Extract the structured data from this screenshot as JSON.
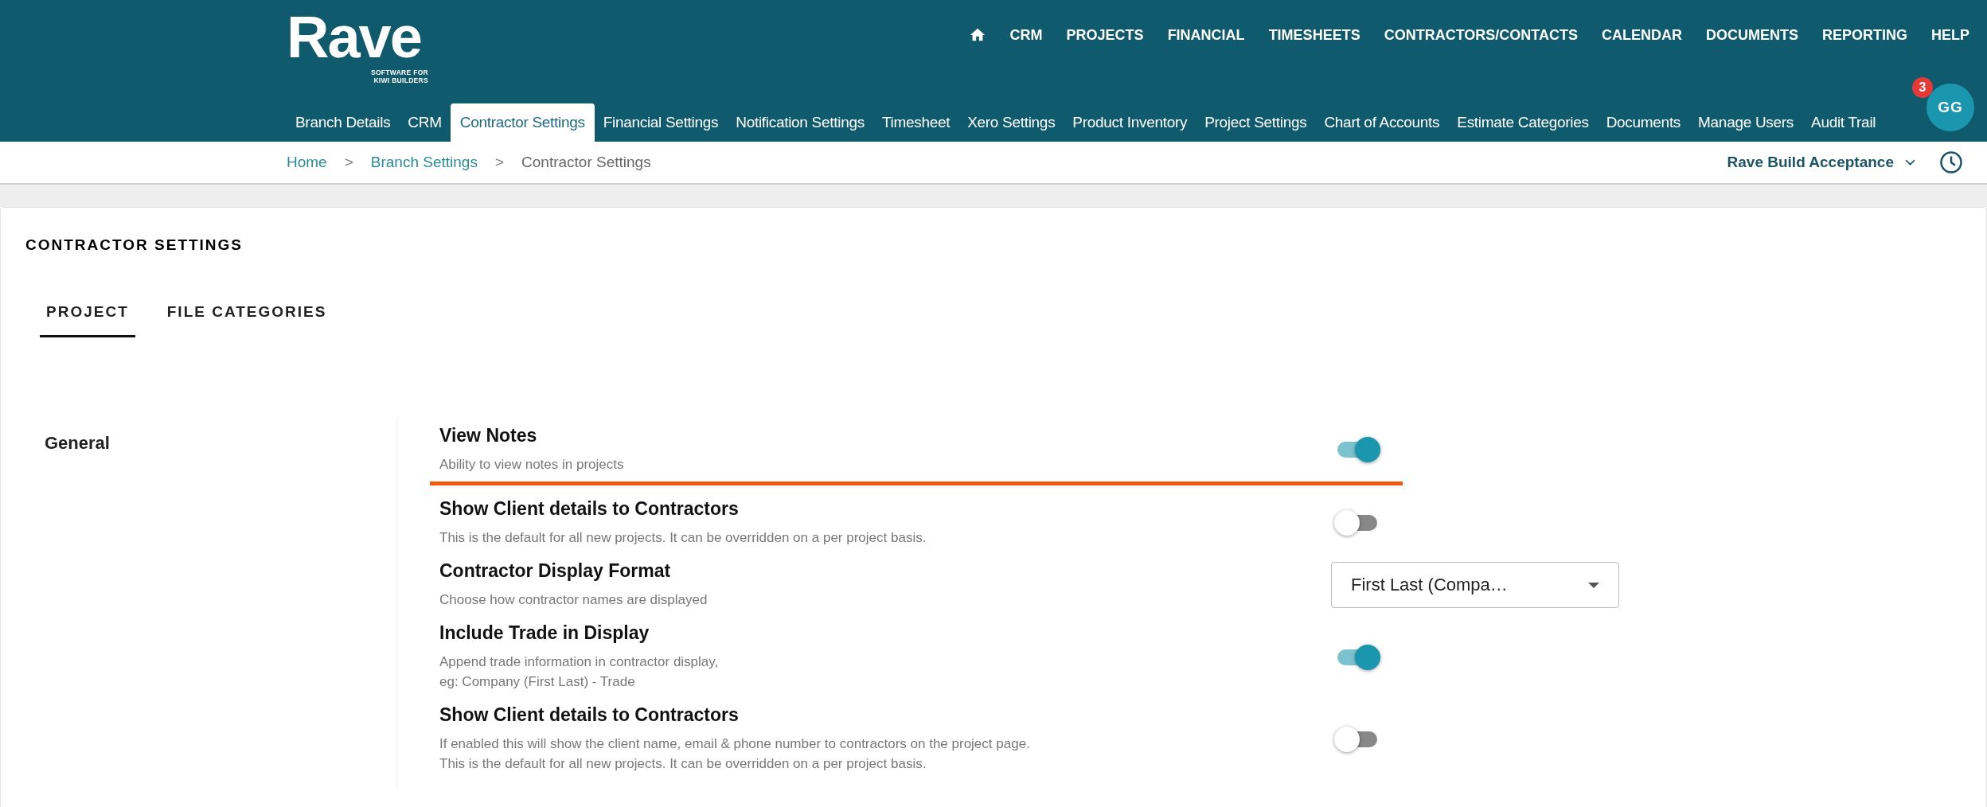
{
  "logo": {
    "name": "Rave",
    "tagline": [
      "SOFTWARE FOR",
      "KIWI BUILDERS"
    ]
  },
  "main_nav": [
    "CRM",
    "PROJECTS",
    "FINANCIAL",
    "TIMESHEETS",
    "CONTRACTORS/CONTACTS",
    "CALENDAR",
    "DOCUMENTS",
    "REPORTING",
    "HELP"
  ],
  "settings_nav": [
    {
      "label": "Branch Details",
      "selected": false
    },
    {
      "label": "CRM",
      "selected": false
    },
    {
      "label": "Contractor Settings",
      "selected": true
    },
    {
      "label": "Financial Settings",
      "selected": false
    },
    {
      "label": "Notification Settings",
      "selected": false
    },
    {
      "label": "Timesheet",
      "selected": false
    },
    {
      "label": "Xero Settings",
      "selected": false
    },
    {
      "label": "Product Inventory",
      "selected": false
    },
    {
      "label": "Project Settings",
      "selected": false
    },
    {
      "label": "Chart of Accounts",
      "selected": false
    },
    {
      "label": "Estimate Categories",
      "selected": false
    },
    {
      "label": "Documents",
      "selected": false
    },
    {
      "label": "Manage Users",
      "selected": false
    },
    {
      "label": "Audit Trail",
      "selected": false
    }
  ],
  "user": {
    "initials": "GG",
    "notifications": "3"
  },
  "breadcrumb": [
    {
      "label": "Home",
      "link": true
    },
    {
      "label": "Branch Settings",
      "link": true
    },
    {
      "label": "Contractor Settings",
      "link": false
    }
  ],
  "separator": ">",
  "organization": "Rave Build Acceptance",
  "page_title": "CONTRACTOR SETTINGS",
  "tabs": [
    {
      "label": "PROJECT",
      "selected": true
    },
    {
      "label": "FILE CATEGORIES",
      "selected": false
    }
  ],
  "section": "General",
  "settings": [
    {
      "kind": "toggle",
      "title": "View Notes",
      "description": [
        "Ability to view notes in projects"
      ],
      "on": true,
      "highlighted": true
    },
    {
      "kind": "toggle",
      "title": "Show Client details to Contractors",
      "description": [
        "This is the default for all new projects. It can be overridden on a per project basis."
      ],
      "on": false,
      "highlighted": false
    },
    {
      "kind": "select",
      "title": "Contractor Display Format",
      "description": [
        "Choose how contractor names are displayed"
      ],
      "value": "First Last (Compa…",
      "highlighted": false
    },
    {
      "kind": "toggle",
      "title": "Include Trade in Display",
      "description": [
        "Append trade information in contractor display,",
        "eg: Company (First Last) - Trade"
      ],
      "on": true,
      "highlighted": false
    },
    {
      "kind": "toggle",
      "title": "Show Client details to Contractors",
      "description": [
        "If enabled this will show the client name, email & phone number to contractors on the project page.",
        "This is the default for all new projects. It can be overridden on a per project basis."
      ],
      "on": false,
      "highlighted": false
    }
  ]
}
